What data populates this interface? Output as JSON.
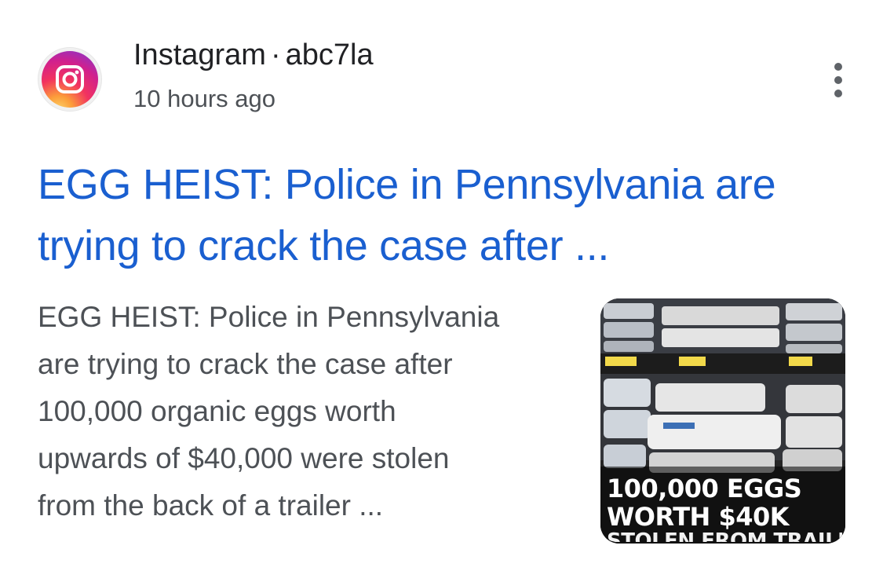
{
  "result": {
    "source": {
      "site": "Instagram",
      "separator": "·",
      "account": "abc7la",
      "time": "10 hours ago",
      "icon": "instagram-logo-icon",
      "more_icon": "more-vert-icon"
    },
    "title_line1": "EGG HEIST: Police in Pennsylvania are",
    "title_line2": "trying to crack the case after ...",
    "snippet_lines": [
      "EGG HEIST: Police in Pennsylvania",
      "are trying to crack the case after",
      "100,000 organic eggs worth",
      "upwards of $40,000 were stolen",
      "from the back of a trailer ..."
    ],
    "thumbnail": {
      "caption_line1": "100,000 EGGS",
      "caption_line2": "WORTH $40K",
      "caption_line3": "STOLEN FROM TRAILER"
    }
  },
  "colors": {
    "title": "#1a5fd0",
    "snippet": "#4d5156",
    "source": "#202124"
  }
}
